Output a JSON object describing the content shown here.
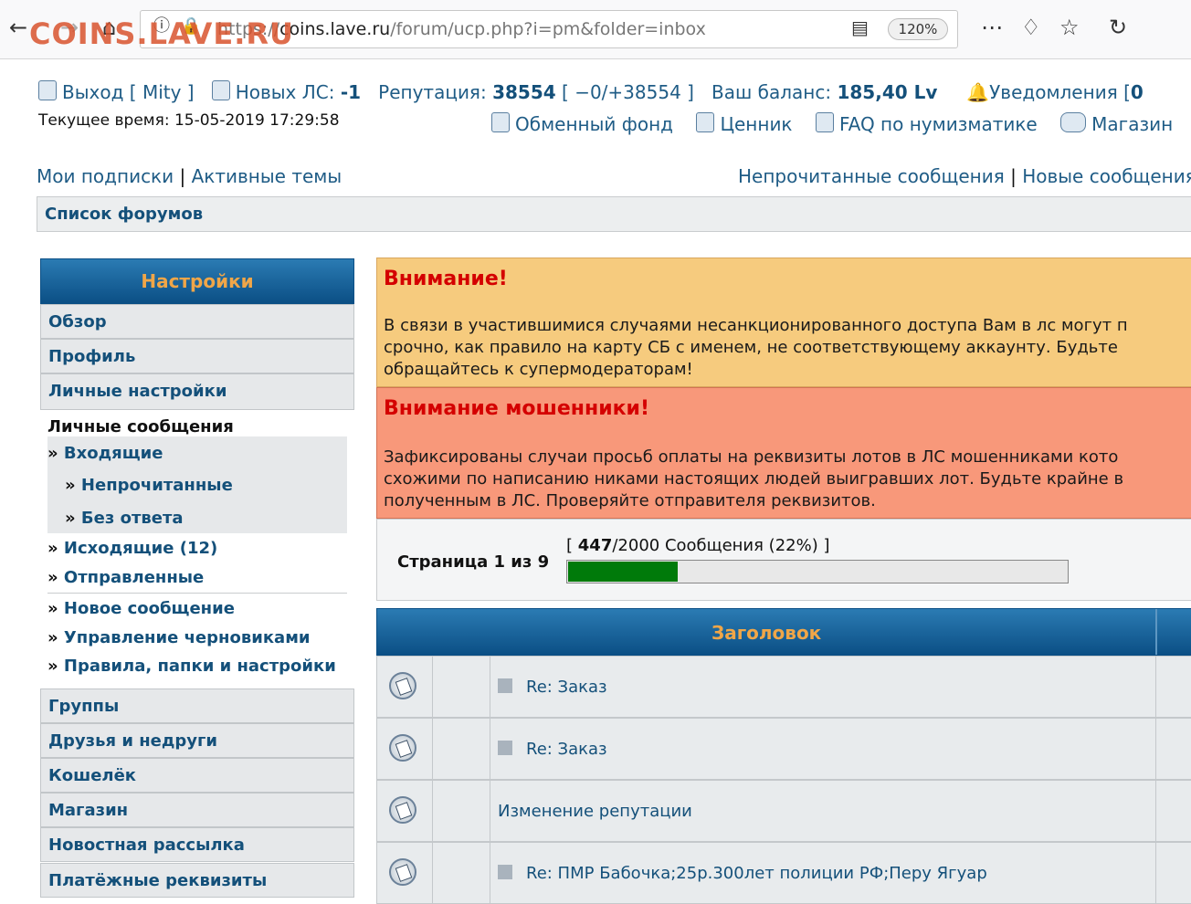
{
  "browser": {
    "url_prefix": "https://",
    "url_host": "coins.lave.ru",
    "url_path": "/forum/ucp.php?i=pm&folder=inbox",
    "zoom": "120%",
    "watermark": "COINS.LAVE.RU"
  },
  "userbar": {
    "logout_prefix": "Выход [",
    "username": "Mity",
    "logout_suffix": "]",
    "new_pm_label": "Новых ЛС:",
    "new_pm_value": "-1",
    "reputation_label": "Репутация:",
    "reputation_value": "38554",
    "reputation_detail": "[ −0/+38554 ]",
    "balance_label": "Ваш баланс:",
    "balance_value": "185,40 Lv",
    "notifications_label": "Уведомления [",
    "notifications_value": "0",
    "current_time": "Текущее время: 15-05-2019 17:29:58"
  },
  "toplinks": {
    "exchange": "Обменный фонд",
    "prices": "Ценник",
    "faq": "FAQ по нумизматике",
    "shop": "Магазин"
  },
  "navlinks": {
    "subscriptions": "Мои подписки",
    "active_topics": "Активные темы",
    "unread_posts": "Непрочитанные сообщения",
    "new_posts": "Новые сообщения",
    "separator": "|"
  },
  "forum_list": "Список форумов",
  "sidebar": {
    "title": "Настройки",
    "overview": "Обзор",
    "profile": "Профиль",
    "personal_settings": "Личные настройки",
    "pm_header": "Личные сообщения",
    "bullet": "»",
    "inbox": "Входящие",
    "unread": "Непрочитанные",
    "no_reply": "Без ответа",
    "outbox": "Исходящие (12)",
    "sent": "Отправленные",
    "new_message": "Новое сообщение",
    "drafts": "Управление черновиками",
    "rules": "Правила, папки и настройки",
    "groups": "Группы",
    "friends": "Друзья и недруги",
    "wallet": "Кошелёк",
    "shop": "Магазин",
    "newsletter": "Новостная рассылка",
    "payment": "Платёжные реквизиты"
  },
  "notice1": {
    "title": "Внимание!",
    "line1": "В связи в участившимися случаями несанкционированного доступа Вам в лс могут п",
    "line2": "срочно, как правило на карту СБ с именем, не соответствующему аккаунту. Будьте",
    "line3": "обращайтесь к супермодераторам!"
  },
  "notice2": {
    "title": "Внимание мошенники!",
    "line1": "Зафиксированы случаи просьб оплаты на реквизиты лотов в ЛС мошенниками кото",
    "line2": "схожими по написанию никами настоящих людей выигравших лот. Будьте крайне в",
    "line3": "полученным в ЛС. Проверяйте отправителя реквизитов."
  },
  "pagination": {
    "label": "Страница 1 из 9",
    "open": "[",
    "count": "447",
    "rest": "/2000 Сообщения (22%)",
    "close": "]",
    "fill_fraction": 0.22
  },
  "table": {
    "header": "Заголовок",
    "rows": [
      {
        "title": "Re: Заказ"
      },
      {
        "title": "Re: Заказ"
      },
      {
        "title": "Изменение репутации"
      },
      {
        "title": "Re: ПМР Бабочка;25р.300лет полиции РФ;Перу Ягуар"
      }
    ]
  },
  "colors": {
    "accent": "#14507a",
    "header_bg": "#0b4f85",
    "header_text": "#f0a648",
    "warning_title": "#d40000",
    "notice1_bg": "#f6cb7e",
    "notice2_bg": "#f8987a",
    "progress_fill": "#007a0a"
  }
}
